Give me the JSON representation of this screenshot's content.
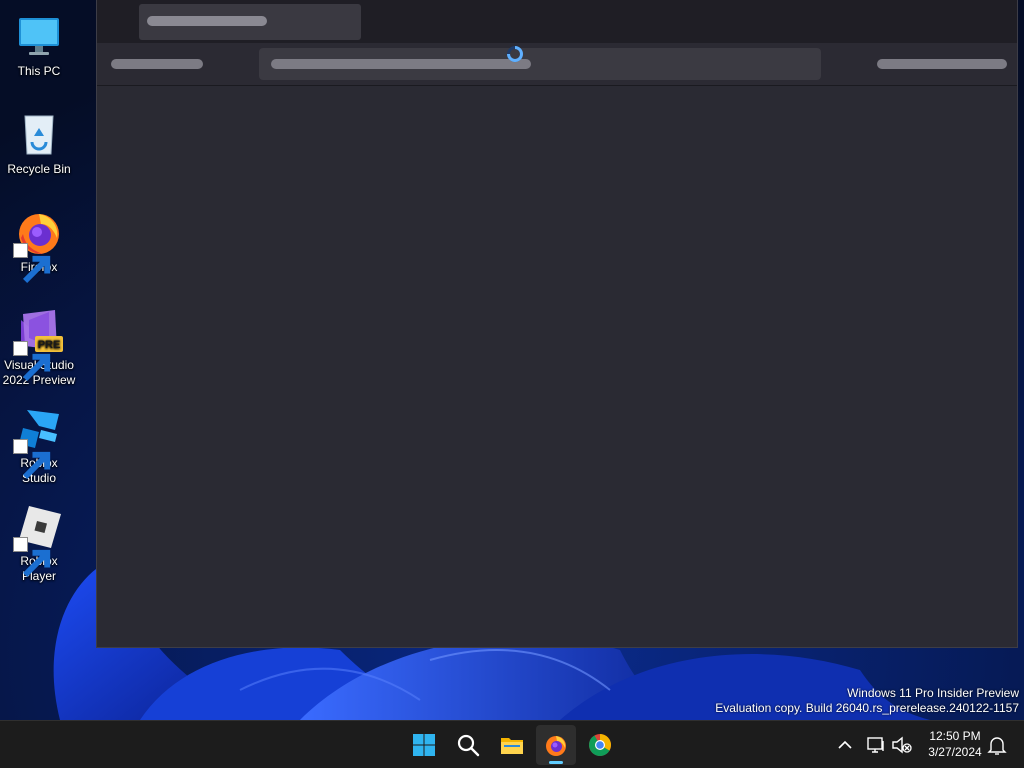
{
  "desktop": {
    "icons": [
      {
        "label": "This PC",
        "icon": "monitor-icon"
      },
      {
        "label": "Recycle Bin",
        "icon": "recycle-bin-icon"
      },
      {
        "label": "Firefox",
        "icon": "firefox-icon"
      },
      {
        "label": "Visual Studio 2022 Preview",
        "icon": "visual-studio-preview-icon",
        "badge": "PRE"
      },
      {
        "label": "Roblox Studio",
        "icon": "roblox-studio-icon"
      },
      {
        "label": "Roblox Player",
        "icon": "roblox-player-icon"
      }
    ]
  },
  "browser_window": {
    "state": "loading",
    "spinner_icon": "loading-spinner-icon",
    "colors": {
      "tab_strip": "#1f1e25",
      "toolbar": "#2b2a33",
      "content": "#2a2a33",
      "spinner": "#60b0ff"
    }
  },
  "watermark": {
    "line1": "Windows 11 Pro Insider Preview",
    "line2": "Evaluation copy. Build 26040.rs_prerelease.240122-1157"
  },
  "taskbar": {
    "pinned": [
      {
        "icon": "windows-start-icon"
      },
      {
        "icon": "search-icon"
      },
      {
        "icon": "file-explorer-icon"
      },
      {
        "icon": "firefox-icon",
        "active": true
      },
      {
        "icon": "chrome-icon"
      }
    ],
    "tray": {
      "icons": [
        "chevron-up-icon",
        "network-icon",
        "volume-muted-icon",
        "notification-bell-icon"
      ],
      "time": "12:50 PM",
      "date": "3/27/2024"
    },
    "accent": "#60cdff"
  }
}
